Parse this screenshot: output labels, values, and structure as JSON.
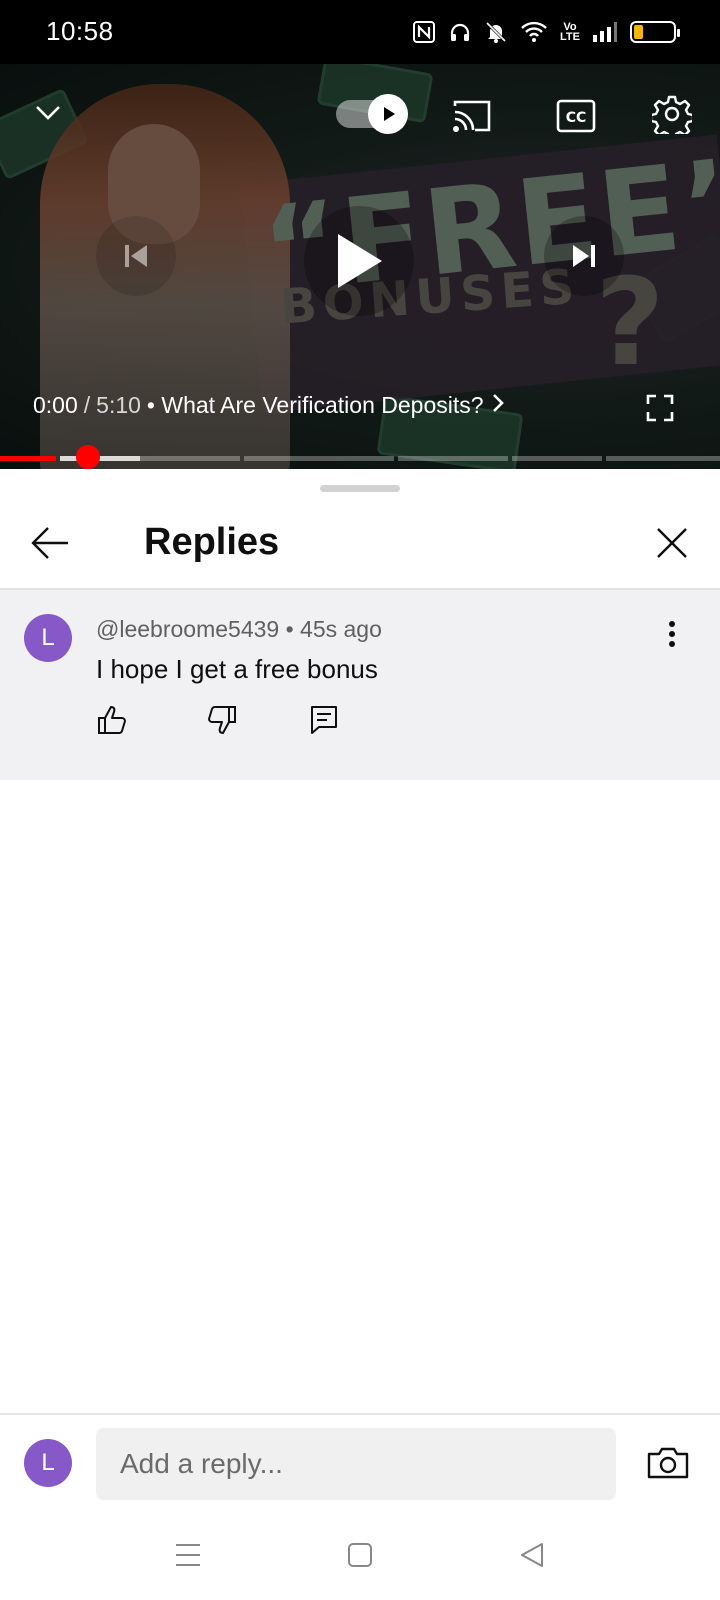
{
  "status_bar": {
    "time": "10:58",
    "icons": [
      "nfc-icon",
      "headphones-icon",
      "mute-icon",
      "wifi-icon",
      "volte-icon",
      "signal-icon",
      "battery-icon"
    ],
    "volte_label": "Vo\nLTE",
    "battery_level": 0.2,
    "battery_color": "#f5b500"
  },
  "player": {
    "current_time": "0:00",
    "separator": "/",
    "duration": "5:10",
    "chapter_title": "• What Are Verification Deposits?",
    "chapter_chevron": "›",
    "thumbnail_text_1": "“FREE”",
    "thumbnail_text_2": "BONUSES",
    "thumbnail_text_3": "?",
    "progress_fraction": 0.0,
    "accent_color": "#ff0000"
  },
  "replies_panel": {
    "title": "Replies",
    "comment": {
      "avatar_letter": "L",
      "avatar_color": "#8658c8",
      "author": "@leebroome5439",
      "time_ago": "45s ago",
      "meta": "@leebroome5439 • 45s ago",
      "text": "I hope I get a free bonus"
    }
  },
  "reply_bar": {
    "avatar_letter": "L",
    "placeholder": "Add a reply..."
  }
}
